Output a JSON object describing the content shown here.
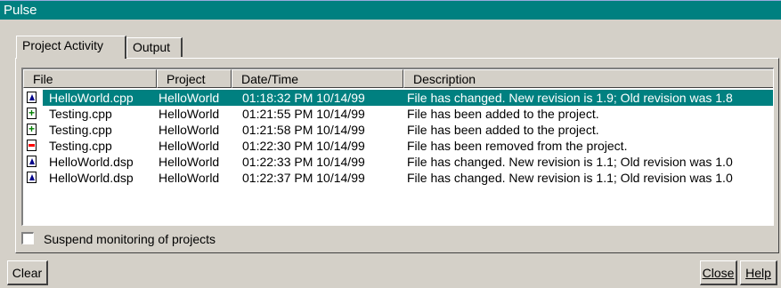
{
  "window": {
    "title": "Pulse"
  },
  "tabs": [
    {
      "label": "Project Activity",
      "active": true
    },
    {
      "label": "Output",
      "active": false
    }
  ],
  "list": {
    "columns": [
      "File",
      "Project",
      "Date/Time",
      "Description"
    ],
    "rows": [
      {
        "icon": "changed-file-icon",
        "file": "HelloWorld.cpp",
        "project": "HelloWorld",
        "datetime": "01:18:32 PM  10/14/99",
        "description": "File has changed. New revision is 1.9; Old revision was 1.8",
        "selected": true
      },
      {
        "icon": "added-file-icon",
        "file": "Testing.cpp",
        "project": "HelloWorld",
        "datetime": "01:21:55 PM  10/14/99",
        "description": "File has been added to the project.",
        "selected": false
      },
      {
        "icon": "added-file-icon",
        "file": "Testing.cpp",
        "project": "HelloWorld",
        "datetime": "01:21:58 PM  10/14/99",
        "description": "File has been added to the project.",
        "selected": false
      },
      {
        "icon": "removed-file-icon",
        "file": "Testing.cpp",
        "project": "HelloWorld",
        "datetime": "01:22:30 PM  10/14/99",
        "description": "File has been removed from the project.",
        "selected": false
      },
      {
        "icon": "changed-file-icon",
        "file": "HelloWorld.dsp",
        "project": "HelloWorld",
        "datetime": "01:22:33 PM  10/14/99",
        "description": "File has changed. New revision is 1.1; Old revision was 1.0",
        "selected": false
      },
      {
        "icon": "changed-file-icon",
        "file": "HelloWorld.dsp",
        "project": "HelloWorld",
        "datetime": "01:22:37 PM  10/14/99",
        "description": "File has changed. New revision is 1.1; Old revision was 1.0",
        "selected": false
      }
    ]
  },
  "options": {
    "suspend_label": "Suspend monitoring of projects",
    "suspend_checked": false
  },
  "buttons": {
    "clear": "Clear",
    "close": "Close",
    "help": "Help"
  },
  "colors": {
    "title_bar": "#008080",
    "selection": "#008080",
    "face": "#d4d0c8"
  }
}
